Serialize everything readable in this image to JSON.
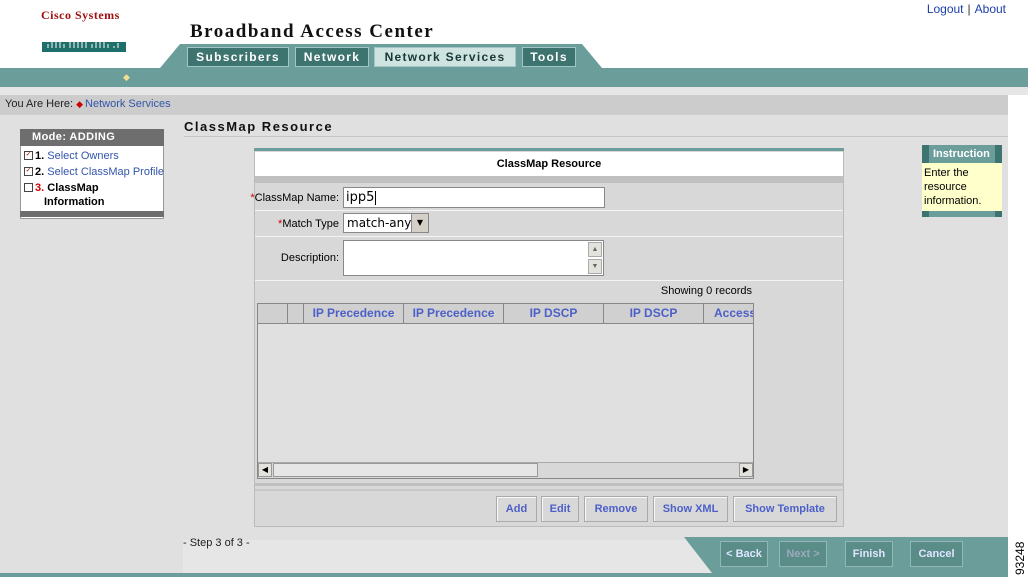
{
  "header": {
    "logo": "Cisco Systems",
    "app_title": "Broadband Access Center",
    "links": {
      "logout": "Logout",
      "separator": "|",
      "about": "About"
    },
    "tabs": [
      {
        "label": "Subscribers",
        "active": false
      },
      {
        "label": "Network",
        "active": false
      },
      {
        "label": "Network Services",
        "active": true
      },
      {
        "label": "Tools",
        "active": false
      }
    ]
  },
  "breadcrumb": {
    "prefix": "You Are Here:",
    "current": "Network Services"
  },
  "mode_panel": {
    "title": "Mode: ADDING",
    "steps": [
      {
        "number": "1.",
        "label": "Select Owners",
        "checked": true
      },
      {
        "number": "2.",
        "label": "Select ClassMap Profile",
        "checked": true
      },
      {
        "number": "3.",
        "label_line1": "ClassMap",
        "label_line2": "Information",
        "checked": false
      }
    ]
  },
  "page": {
    "section_title": "ClassMap Resource"
  },
  "form": {
    "title": "ClassMap Resource",
    "required_mark": "*",
    "name_label": "ClassMap Name:",
    "name_value": "ipp5",
    "match_label": "Match Type",
    "match_value": "match-any",
    "desc_label": "Description:",
    "desc_value": "",
    "records_text": "Showing 0 records",
    "columns": [
      "",
      "",
      "IP Precedence",
      "IP Precedence",
      "IP DSCP",
      "IP DSCP",
      "Access"
    ],
    "buttons": [
      "Add",
      "Edit",
      "Remove",
      "Show XML",
      "Show Template"
    ]
  },
  "instruction": {
    "title": "Instruction",
    "text_lines": [
      "Enter the",
      "resource",
      "information."
    ]
  },
  "footer": {
    "step_text": "- Step 3 of 3 -",
    "nav": [
      {
        "label": "< Back",
        "enabled": true
      },
      {
        "label": "Next >",
        "enabled": false
      },
      {
        "label": "Finish",
        "enabled": true
      },
      {
        "label": "Cancel",
        "enabled": true
      }
    ]
  },
  "figure_number": "93248",
  "colors": {
    "teal": "#6b9e9a",
    "dark_teal": "#3e7470",
    "link_blue": "#3355aa",
    "header_blue": "#4c60c8",
    "required_red": "#cc0000",
    "instruction_bg": "#ffffcc"
  },
  "icons": {
    "checkbox": "checked-checkbox-icon",
    "dropdown": "chevron-down-icon",
    "scroll": "scroll-arrow-icon"
  }
}
